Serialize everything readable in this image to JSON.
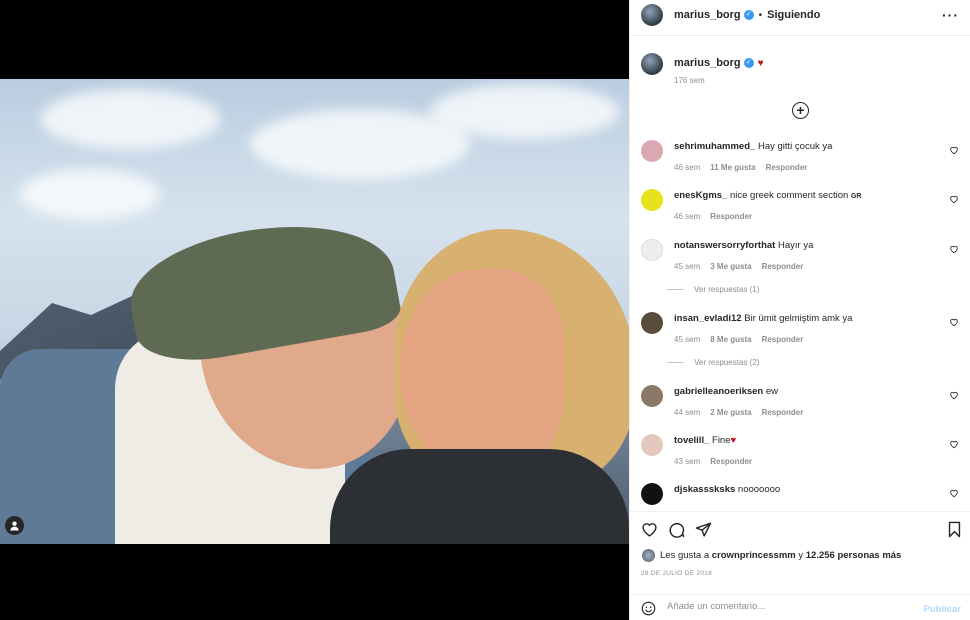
{
  "post": {
    "author": "marius_borg",
    "follow_label": "Siguiendo",
    "separator": "•",
    "more_icon": "···",
    "caption_heart": "♥",
    "caption_time": "176 sem",
    "load_more_icon": "+"
  },
  "comments": [
    {
      "user": "sehrimuhammed_",
      "text": "Hay gitti çocuk ya",
      "time": "46 sem",
      "likes": "11 Me gusta",
      "reply": "Responder",
      "avatar_color": "#d9a8b0"
    },
    {
      "user": "enesKgms_",
      "text": "nice greek comment section",
      "suffix": "GR",
      "time": "46 sem",
      "likes": "",
      "reply": "Responder",
      "avatar_color": "#e6e21c"
    },
    {
      "user": "notanswersorryforthat",
      "text": "Hayır ya",
      "time": "45 sem",
      "likes": "3 Me gusta",
      "reply": "Responder",
      "replies": "Ver respuestas (1)",
      "avatar_color": "#eeeeee"
    },
    {
      "user": "insan_evladi12",
      "text": "Bir ümit gelmiştim amk ya",
      "time": "45 sem",
      "likes": "8 Me gusta",
      "reply": "Responder",
      "replies": "Ver respuestas (2)",
      "avatar_color": "#5a4c3c"
    },
    {
      "user": "gabrielleanoeriksen",
      "text": "ew",
      "time": "44 sem",
      "likes": "2 Me gusta",
      "reply": "Responder",
      "avatar_color": "#8a7868"
    },
    {
      "user": "tovelill_",
      "text": "Fine",
      "heart": "♥",
      "time": "43 sem",
      "likes": "",
      "reply": "Responder",
      "avatar_color": "#e4c8be"
    },
    {
      "user": "djskasssksks",
      "text": "nooooooo",
      "time": "",
      "likes": "",
      "reply": "",
      "avatar_color": "#111111"
    }
  ],
  "likes_summary": {
    "prefix": "Les gusta a",
    "user": "crownprincessmm",
    "middle": "y",
    "count": "12.256 personas más"
  },
  "date": "28 DE JULIO DE 2018",
  "add_comment": {
    "placeholder": "Añade un comentario...",
    "publish": "Publicar"
  },
  "colors": {
    "accent": "#3897f0",
    "publish_disabled": "#b3dbff",
    "heart": "#c1121f"
  }
}
